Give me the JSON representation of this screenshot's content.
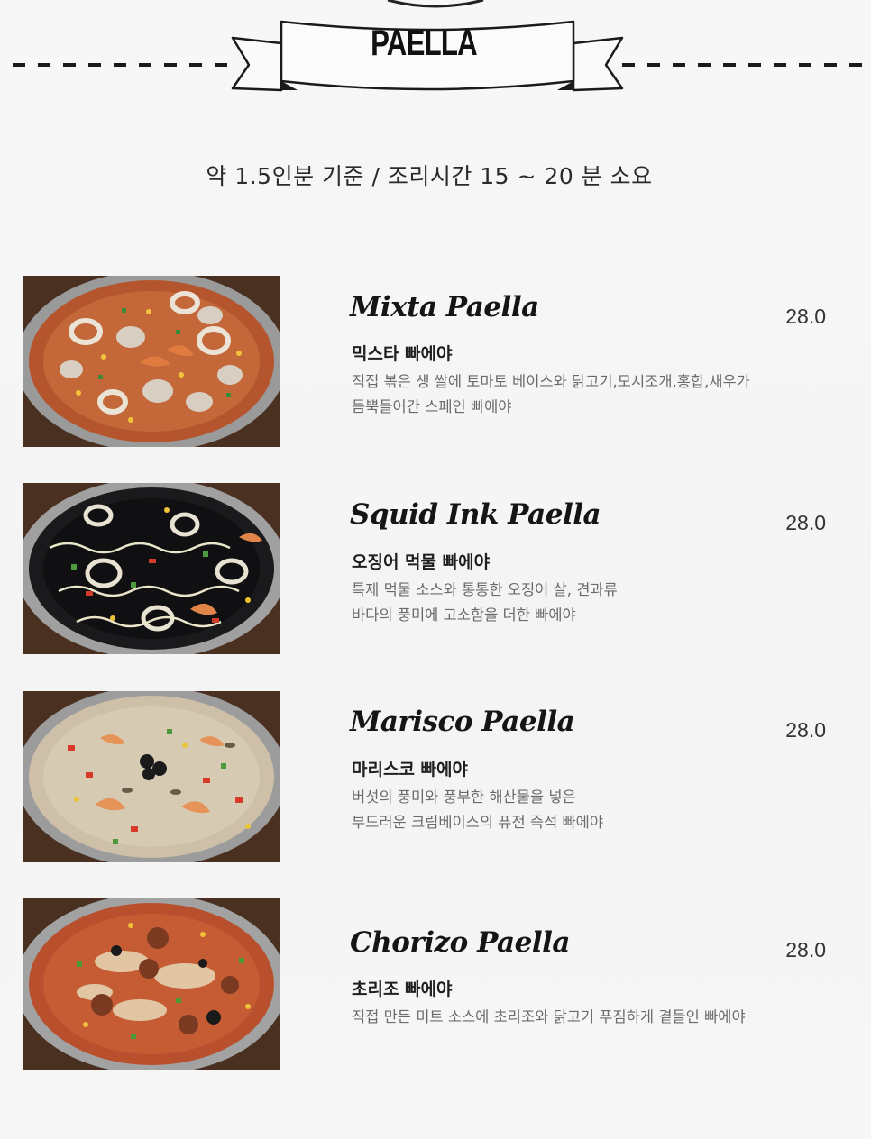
{
  "header": {
    "title": "PAELLA",
    "subtitle": "약 1.5인분 기준  / 조리시간 15 ~ 20 분 소요"
  },
  "menu": [
    {
      "name": "Mixta Paella",
      "price": "28.0",
      "korean_name": "믹스타 빠에야",
      "desc_line1": "직접 볶은 생 쌀에 토마토 베이스와 닭고기,모시조개,홍합,새우가",
      "desc_line2": "듬뿍들어간 스페인 빠에야"
    },
    {
      "name": "Squid Ink Paella",
      "price": "28.0",
      "korean_name": "오징어 먹물 빠에야",
      "desc_line1": "특제 먹물 소스와 통통한 오징어 살, 견과류",
      "desc_line2": "바다의 풍미에 고소함을 더한 빠에야"
    },
    {
      "name": "Marisco Paella",
      "price": "28.0",
      "korean_name": "마리스코 빠에야",
      "desc_line1": "버섯의 풍미와 풍부한 해산물을 넣은",
      "desc_line2": "부드러운 크림베이스의 퓨전 즉석 빠에야"
    },
    {
      "name": "Chorizo Paella",
      "price": "28.0",
      "korean_name": "초리조 빠에야",
      "desc_line1": "직접 만든 미트 소스에 초리조와 닭고기 푸짐하게 곁들인 빠에야"
    }
  ]
}
